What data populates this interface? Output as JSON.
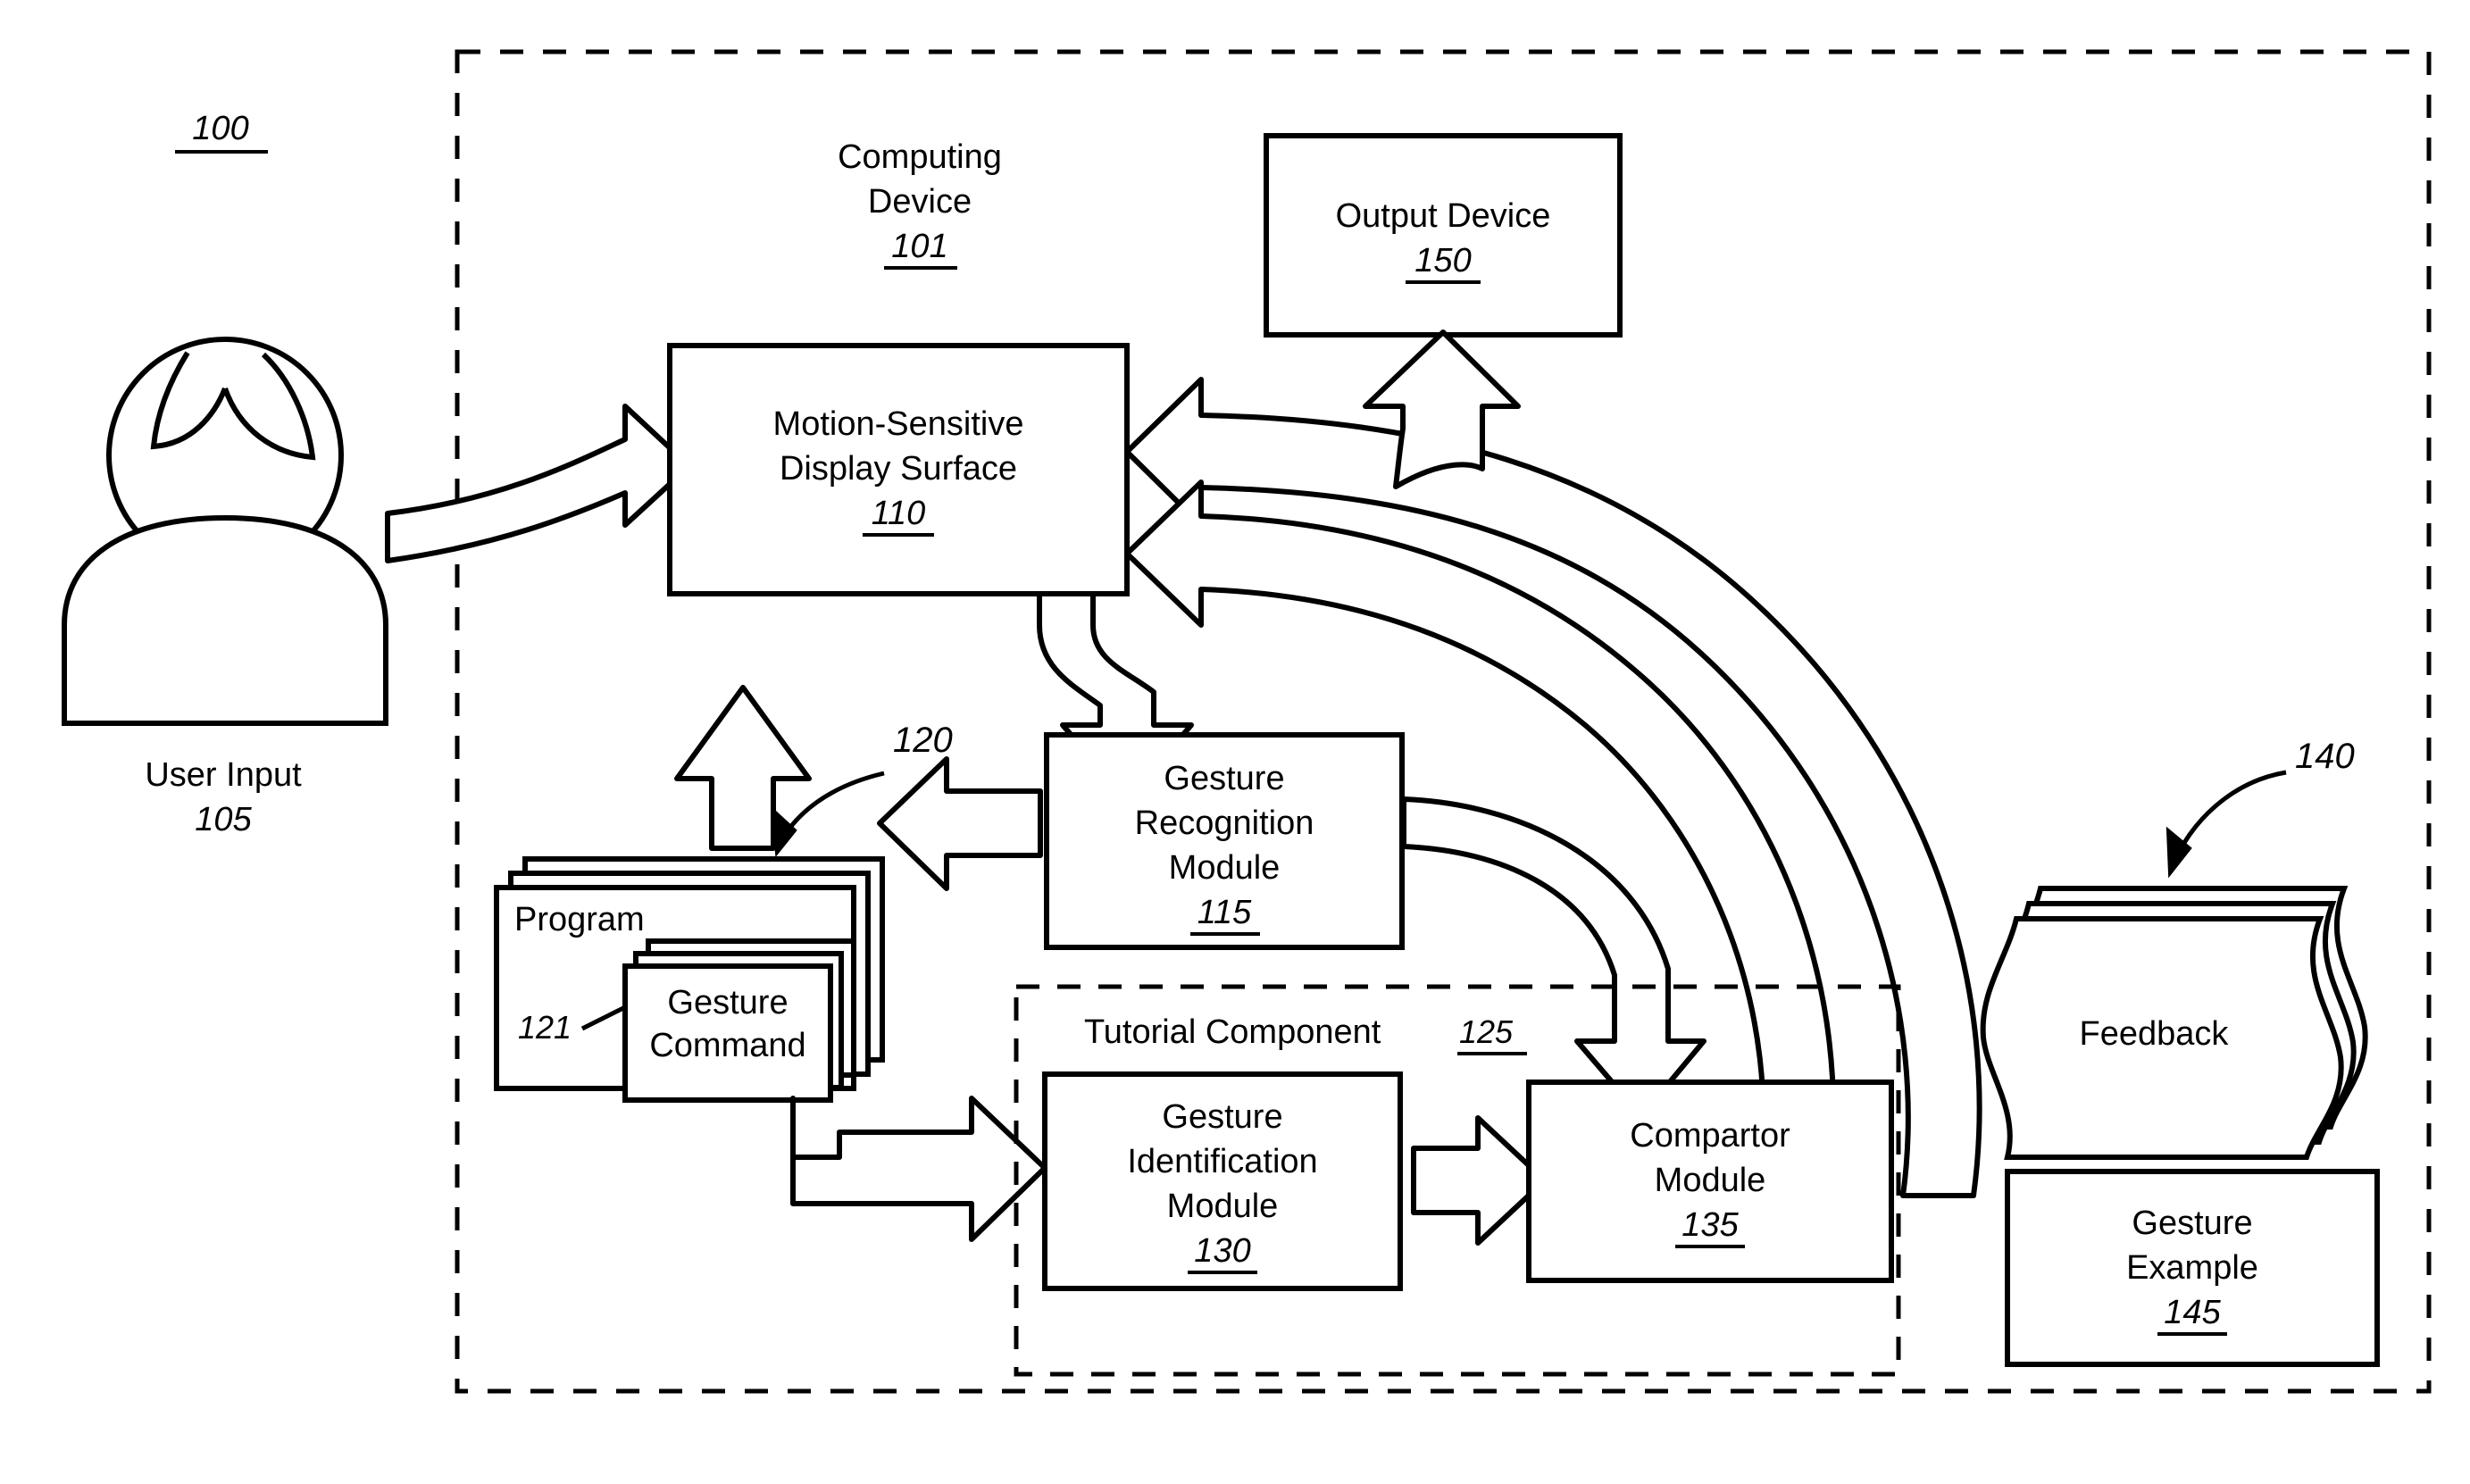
{
  "figure": {
    "figure_ref": "100",
    "system_header": {
      "line1": "Computing",
      "line2": "Device",
      "ref": "101"
    }
  },
  "actor": {
    "name": "User Input",
    "ref": "105",
    "icon": "person-icon"
  },
  "blocks": [
    {
      "id": "display-surface",
      "lines": [
        "Motion-Sensitive",
        "Display Surface"
      ],
      "ref": "110"
    },
    {
      "id": "output-device",
      "lines": [
        "Output Device"
      ],
      "ref": "150"
    },
    {
      "id": "gesture-recognition-module",
      "lines": [
        "Gesture",
        "Recognition",
        "Module"
      ],
      "ref": "115"
    },
    {
      "id": "gesture-identification-module",
      "lines": [
        "Gesture",
        "Identification",
        "Module"
      ],
      "ref": "130"
    },
    {
      "id": "compartor-module",
      "lines": [
        "Compartor",
        "Module"
      ],
      "ref": "135"
    },
    {
      "id": "gesture-example",
      "lines": [
        "Gesture",
        "Example"
      ],
      "ref": "145"
    }
  ],
  "program_stack": {
    "label": "Program",
    "ref": "120",
    "inner": {
      "lines": [
        "Gesture",
        "Command"
      ],
      "ref": "121"
    }
  },
  "tutorial_component": {
    "label": "Tutorial Component",
    "ref": "125"
  },
  "feedback": {
    "label": "Feedback",
    "ref": "140"
  },
  "colors": {
    "stroke": "#000000",
    "fill": "#ffffff",
    "background": "#ffffff"
  }
}
